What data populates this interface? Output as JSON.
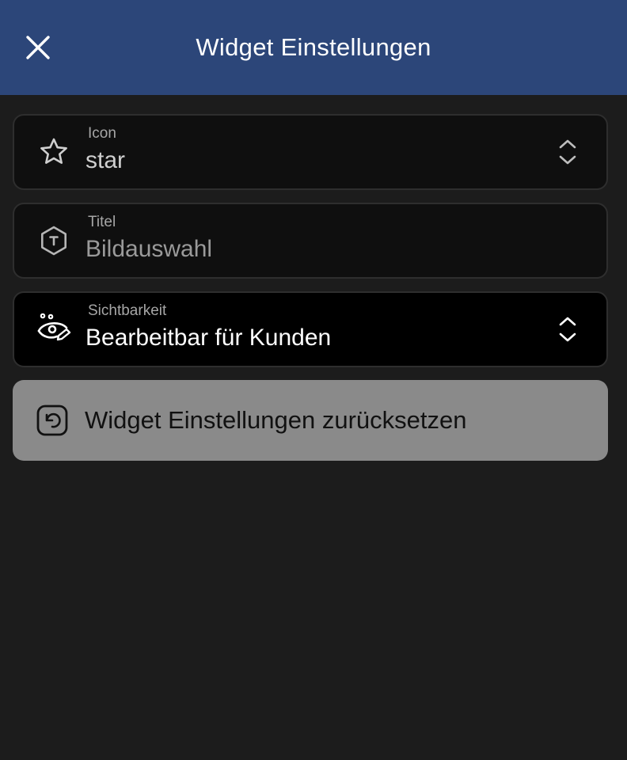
{
  "header": {
    "title": "Widget Einstellungen",
    "close_icon": "close-icon",
    "background": "#2c4679"
  },
  "fields": {
    "icon": {
      "label": "Icon",
      "value": "star",
      "leading_icon": "star-icon",
      "trailing_icon": "chevron-up-down-icon"
    },
    "titel": {
      "label": "Titel",
      "placeholder": "Bildauswahl",
      "leading_icon": "text-hexagon-icon"
    },
    "sichtbarkeit": {
      "label": "Sichtbarkeit",
      "value": "Bearbeitbar für Kunden",
      "leading_icon": "visibility-edit-icon",
      "trailing_icon": "chevron-up-down-icon"
    }
  },
  "reset": {
    "label": "Widget Einstellungen zurücksetzen",
    "icon": "reset-icon",
    "background": "#8a8a8a"
  }
}
